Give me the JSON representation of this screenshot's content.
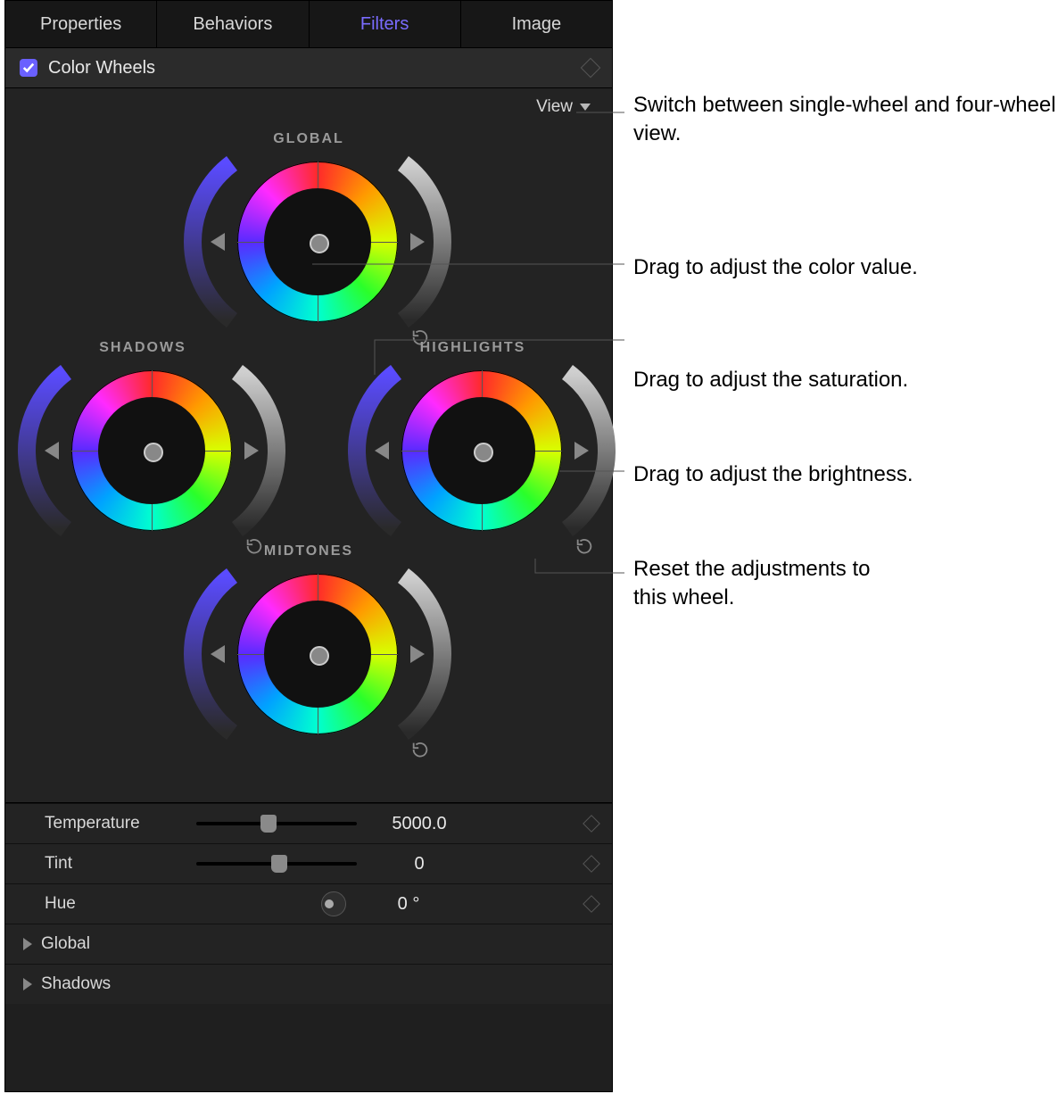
{
  "tabs": {
    "properties": "Properties",
    "behaviors": "Behaviors",
    "filters": "Filters",
    "image": "Image"
  },
  "section": {
    "title": "Color Wheels"
  },
  "view": {
    "label": "View"
  },
  "wheels": {
    "global": "GLOBAL",
    "shadows": "SHADOWS",
    "highlights": "HIGHLIGHTS",
    "midtones": "MIDTONES"
  },
  "params": {
    "temperature_label": "Temperature",
    "temperature_value": "5000.0",
    "tint_label": "Tint",
    "tint_value": "0",
    "hue_label": "Hue",
    "hue_value": "0 °"
  },
  "disclosure": {
    "global": "Global",
    "shadows": "Shadows"
  },
  "callouts": {
    "c1": "Switch between single-wheel and four-wheel view.",
    "c2": "Drag to adjust the color value.",
    "c3": "Drag to adjust the saturation.",
    "c4": "Drag to adjust the brightness.",
    "c5a": "Reset the adjustments to",
    "c5b": "this wheel."
  }
}
